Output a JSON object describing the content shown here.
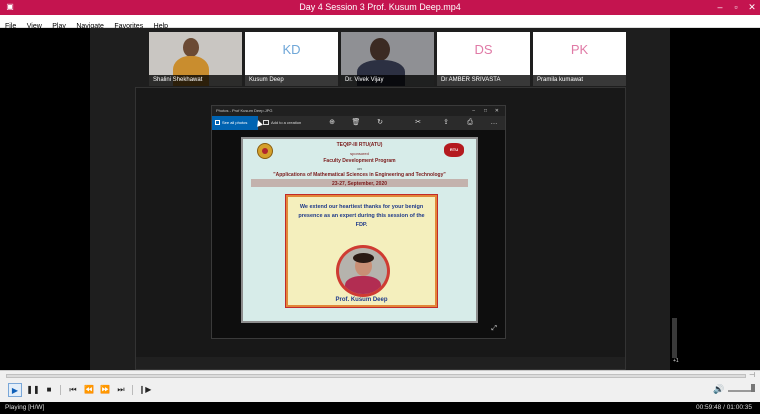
{
  "window": {
    "title": "Day 4 Session 3 Prof. Kusum Deep.mp4",
    "minimize_icon": "minimize-icon",
    "maximize_icon": "maximize-icon",
    "close_icon": "close-icon"
  },
  "menu": [
    "File",
    "View",
    "Play",
    "Navigate",
    "Favorites",
    "Help"
  ],
  "participants": [
    {
      "name": "Shalini Shekhawat",
      "initials": ""
    },
    {
      "name": "Kusum Deep",
      "initials": "KD"
    },
    {
      "name": "Dr. Vivek Vijay",
      "initials": ""
    },
    {
      "name": "Dr AMBER SRIVASTA",
      "initials": "DS"
    },
    {
      "name": "Pramila kumawat",
      "initials": "PK"
    }
  ],
  "photos_app": {
    "title": "Photos - Prof Kusum Deep.JPG",
    "see_all": "See all photos",
    "add_to_creation": "Add to a creation"
  },
  "slide": {
    "org": "TEQIP-III RTU(ATU)",
    "sponsored": "sponsored",
    "program": "Faculty Development Program",
    "on": "on",
    "topic": "\"Applications of Mathematical Sciences in Engineering and Technology\"",
    "dates": "23-27, September, 2020",
    "logo_right": "RTU",
    "message": "We extend our heartiest thanks for your benign presence as an expert during this session of the FDP.",
    "caption": "Prof. Kusum Deep"
  },
  "overlay": {
    "more_count": "+1"
  },
  "status": {
    "state": "Playing [H/W]",
    "time": "00:59:48 / 01:00:35"
  },
  "colors": {
    "titlebar": "#c4144f",
    "accent": "#0063b1"
  }
}
